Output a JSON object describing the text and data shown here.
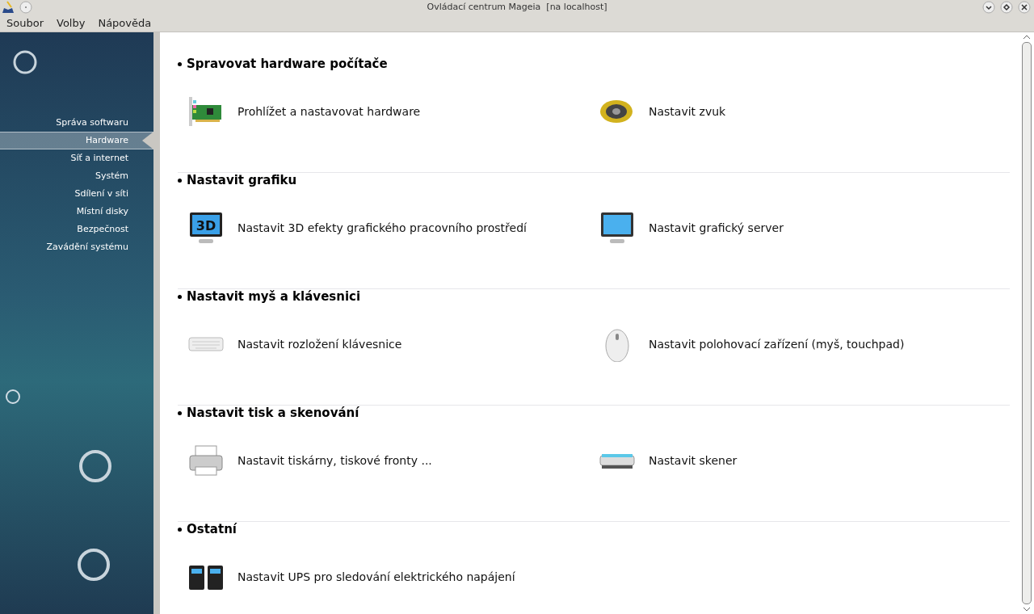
{
  "window": {
    "title": "Ovládací centrum Mageia  [na localhost]"
  },
  "menu": [
    "Soubor",
    "Volby",
    "Nápověda"
  ],
  "sidebar": {
    "items": [
      {
        "label": "Správa softwaru",
        "selected": false
      },
      {
        "label": "Hardware",
        "selected": true
      },
      {
        "label": "Síť a internet",
        "selected": false
      },
      {
        "label": "Systém",
        "selected": false
      },
      {
        "label": "Sdílení v síti",
        "selected": false
      },
      {
        "label": "Místní disky",
        "selected": false
      },
      {
        "label": "Bezpečnost",
        "selected": false
      },
      {
        "label": "Zavádění systému",
        "selected": false
      }
    ]
  },
  "sections": [
    {
      "title": "Spravovat hardware počítače",
      "items": [
        {
          "label": "Prohlížet a nastavovat hardware",
          "kind": "card"
        },
        {
          "label": "Nastavit zvuk",
          "kind": "speaker"
        }
      ]
    },
    {
      "title": "Nastavit grafiku",
      "items": [
        {
          "label": "Nastavit 3D efekty grafického pracovního prostředí",
          "kind": "monitor3d",
          "icon_text": "3D"
        },
        {
          "label": "Nastavit grafický server",
          "kind": "monitor"
        }
      ]
    },
    {
      "title": "Nastavit myš a klávesnici",
      "items": [
        {
          "label": "Nastavit rozložení klávesnice",
          "kind": "keyboard"
        },
        {
          "label": "Nastavit polohovací zařízení (myš, touchpad)",
          "kind": "mouse"
        }
      ]
    },
    {
      "title": "Nastavit tisk a skenování",
      "items": [
        {
          "label": "Nastavit tiskárny, tiskové fronty ...",
          "kind": "printer"
        },
        {
          "label": "Nastavit skener",
          "kind": "scanner"
        }
      ]
    },
    {
      "title": "Ostatní",
      "items": [
        {
          "label": "Nastavit UPS pro sledování elektrického napájení",
          "kind": "ups"
        }
      ]
    }
  ]
}
